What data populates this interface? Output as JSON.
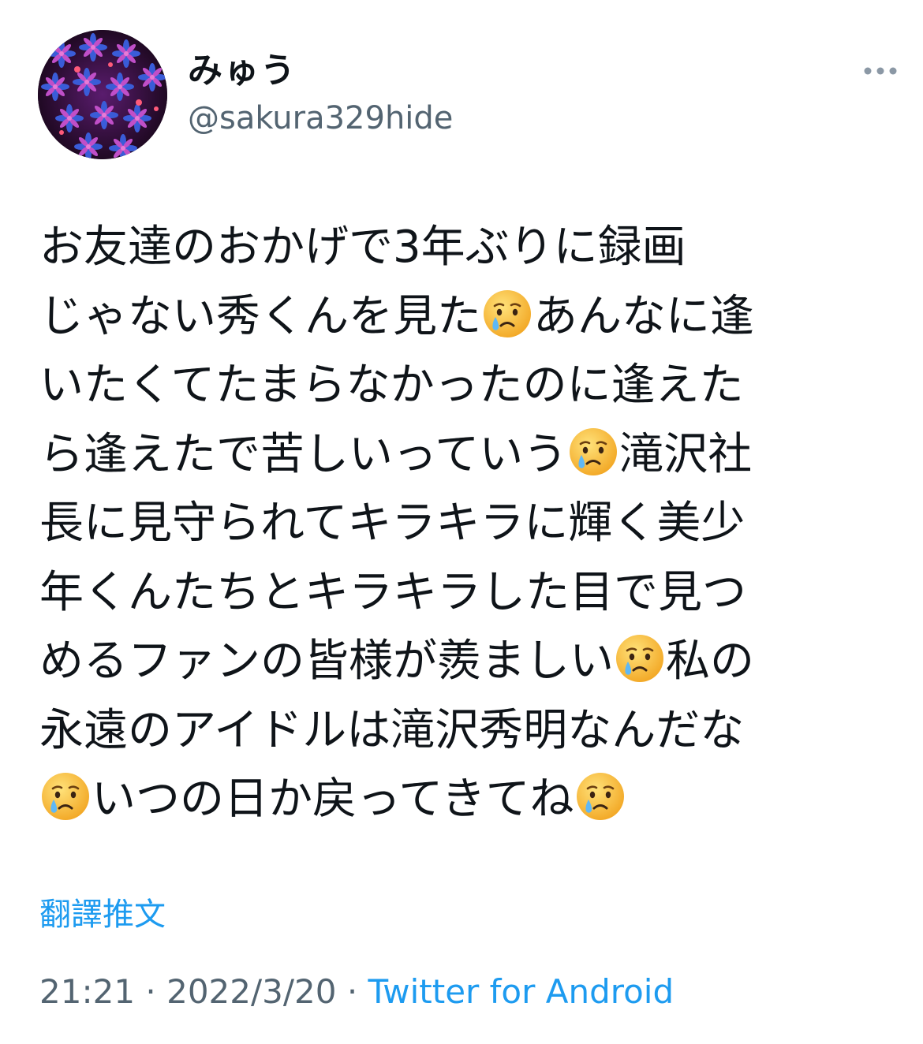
{
  "user": {
    "display_name": "みゅう",
    "handle": "@sakura329hide"
  },
  "tweet": {
    "segments": [
      {
        "type": "text",
        "value": "お友達のおかげで3年ぶりに録画\nじゃない秀くんを見た"
      },
      {
        "type": "emoji",
        "name": "crying-face-emoji"
      },
      {
        "type": "text",
        "value": "あんなに逢\nいたくてたまらなかったのに逢えた\nら逢えたで苦しいっていう"
      },
      {
        "type": "emoji",
        "name": "crying-face-emoji"
      },
      {
        "type": "text",
        "value": "滝沢社\n長に見守られてキラキラに輝く美少\n年くんたちとキラキラした目で見つ\nめるファンの皆様が羨ましい"
      },
      {
        "type": "emoji",
        "name": "crying-face-emoji"
      },
      {
        "type": "text",
        "value": "私の\n永遠のアイドルは滝沢秀明なんだな\n"
      },
      {
        "type": "emoji",
        "name": "crying-face-emoji"
      },
      {
        "type": "text",
        "value": "いつの日か戻ってきてね"
      },
      {
        "type": "emoji",
        "name": "crying-face-emoji"
      }
    ],
    "translate_label": "翻譯推文",
    "time": "21:21",
    "separator": " · ",
    "date": "2022/3/20",
    "source": "Twitter for Android"
  },
  "icons": {
    "more": "more-horizontal-icon",
    "emoji": "crying-face-emoji"
  },
  "colors": {
    "link": "#1d9bf0",
    "secondary_text": "#536471",
    "primary_text": "#0f1419",
    "background": "#ffffff"
  }
}
